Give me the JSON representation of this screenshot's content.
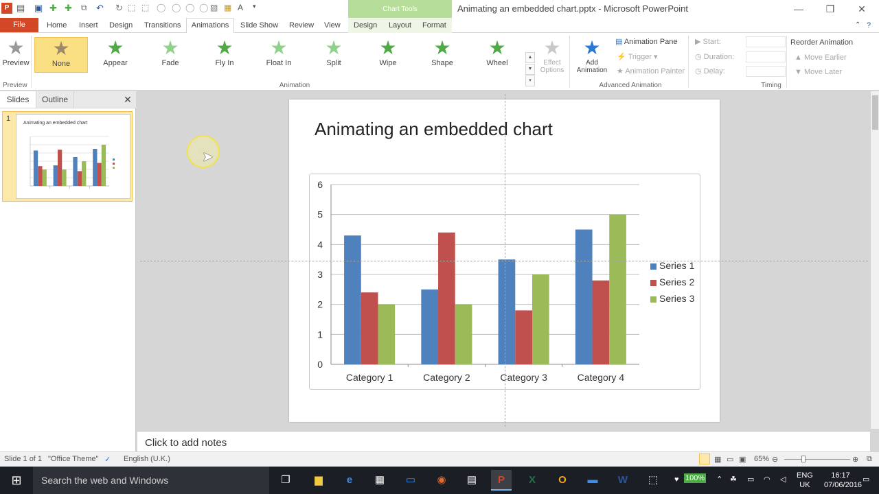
{
  "app": {
    "window_title": "Animating an embedded chart.pptx - Microsoft PowerPoint",
    "context_tab_header": "Chart Tools",
    "logo_letter": "P"
  },
  "tabs": {
    "file": "File",
    "home": "Home",
    "insert": "Insert",
    "design": "Design",
    "transitions": "Transitions",
    "animations": "Animations",
    "slideshow": "Slide Show",
    "review": "Review",
    "view": "View",
    "ctx_design": "Design",
    "ctx_layout": "Layout",
    "ctx_format": "Format"
  },
  "ribbon": {
    "preview": {
      "label": "Preview",
      "group": "Preview"
    },
    "animations": [
      "None",
      "Appear",
      "Fade",
      "Fly In",
      "Float In",
      "Split",
      "Wipe",
      "Shape",
      "Wheel"
    ],
    "selected_animation": "None",
    "effect_options": {
      "line1": "Effect",
      "line2": "Options"
    },
    "animation_group": "Animation",
    "add_animation": {
      "line1": "Add",
      "line2": "Animation"
    },
    "animation_pane": "Animation Pane",
    "trigger": "Trigger",
    "animation_painter": "Animation Painter",
    "advanced_group": "Advanced Animation",
    "start": "Start:",
    "duration": "Duration:",
    "delay": "Delay:",
    "timing_group": "Timing",
    "reorder": "Reorder Animation",
    "move_earlier": "Move Earlier",
    "move_later": "Move Later"
  },
  "panel": {
    "tab_slides": "Slides",
    "tab_outline": "Outline",
    "slide_number": "1",
    "thumb_title": "Animating an embedded chart"
  },
  "slide": {
    "title": "Animating an embedded chart"
  },
  "chart_data": {
    "type": "bar",
    "categories": [
      "Category 1",
      "Category 2",
      "Category 3",
      "Category 4"
    ],
    "series": [
      {
        "name": "Series 1",
        "color": "#4f81bd",
        "values": [
          4.3,
          2.5,
          3.5,
          4.5
        ]
      },
      {
        "name": "Series 2",
        "color": "#c0504d",
        "values": [
          2.4,
          4.4,
          1.8,
          2.8
        ]
      },
      {
        "name": "Series 3",
        "color": "#9bbb59",
        "values": [
          2,
          2,
          3,
          5
        ]
      }
    ],
    "ylim": [
      0,
      6
    ],
    "yticks": [
      "0",
      "1",
      "2",
      "3",
      "4",
      "5",
      "6"
    ],
    "grid": true,
    "legend": "right"
  },
  "notes": {
    "placeholder": "Click to add notes"
  },
  "status": {
    "slide": "Slide 1 of 1",
    "theme": "\"Office Theme\"",
    "language": "English (U.K.)",
    "zoom": "65%"
  },
  "taskbar": {
    "search": "Search the web and Windows",
    "battery": "100%",
    "lang1": "ENG",
    "lang2": "UK",
    "time": "16:17",
    "date": "07/06/2016"
  }
}
